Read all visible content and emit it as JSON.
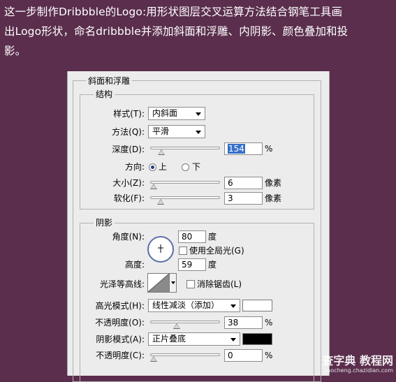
{
  "intro": {
    "line1": "这一步制作Dribbble的Logo:用形状图层交叉运算方法结合钢笔工具画",
    "line2": "出Logo形状，命名dribbble并添加斜面和浮雕、内阴影、颜色叠加和投",
    "line3": "影。"
  },
  "panel": {
    "title": "斜面和浮雕",
    "structure": {
      "legend": "结构",
      "style_label": "样式(T):",
      "style_value": "内斜面",
      "technique_label": "方法(Q):",
      "technique_value": "平滑",
      "depth_label": "深度(D):",
      "depth_value": "154",
      "depth_percent": 15.4,
      "depth_unit": "%",
      "direction_label": "方向:",
      "direction_up": "上",
      "direction_down": "下",
      "size_label": "大小(Z):",
      "size_value": "6",
      "size_unit": "像素",
      "soften_label": "软化(F):",
      "soften_value": "3",
      "soften_unit": "像素"
    },
    "shading": {
      "legend": "阴影",
      "angle_label": "角度(N):",
      "angle_value": "80",
      "angle_unit": "度",
      "global_light_label": "使用全局光(G)",
      "altitude_label": "高度:",
      "altitude_value": "59",
      "altitude_unit": "度",
      "gloss_label": "光泽等高线:",
      "antialias_label": "消除锯齿(L)",
      "highlight_mode_label": "高光模式(H):",
      "highlight_mode_value": "线性减淡（添加）",
      "highlight_color": "#ffffff",
      "highlight_opacity_label": "不透明度(O):",
      "highlight_opacity_value": "38",
      "highlight_opacity_unit": "%",
      "shadow_mode_label": "阴影模式(A):",
      "shadow_mode_value": "正片叠底",
      "shadow_color": "#000000",
      "shadow_opacity_label": "不透明度(C):",
      "shadow_opacity_value": "0",
      "shadow_opacity_unit": "%"
    }
  },
  "watermark": {
    "main": "查字典 教程网",
    "sub": "jiaocheng.chazidian.com"
  }
}
